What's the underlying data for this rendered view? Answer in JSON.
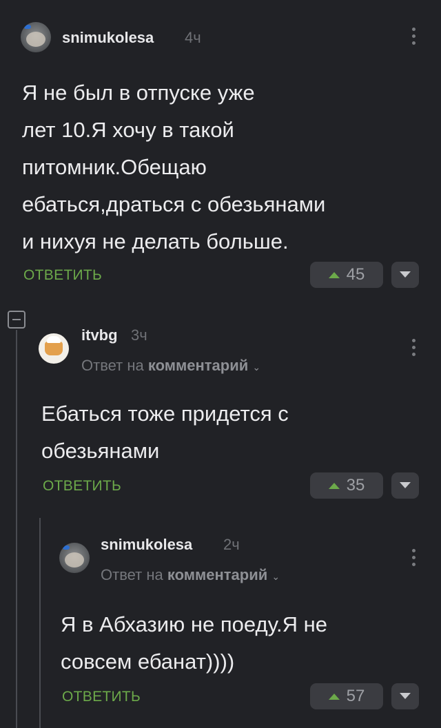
{
  "comments": [
    {
      "username": "snimukolesa",
      "time": "4ч",
      "lines": [
        "Я не был в отпуске уже",
        "лет 10.Я хочу в такой",
        "питомник.Обещаю",
        "ебаться,драться с обезьянами",
        "и нихуя не делать больше."
      ],
      "reply_label": "ОТВЕТИТЬ",
      "votes": "45",
      "avatar_icon": "monkey-avatar-icon"
    },
    {
      "username": "itvbg",
      "time": "3ч",
      "reply_to_prefix": "Ответ на",
      "reply_to_target": "комментарий",
      "lines": [
        "Ебаться тоже придется с",
        "обезьянами"
      ],
      "reply_label": "ОТВЕТИТЬ",
      "votes": "35",
      "avatar_icon": "chef-avatar-icon"
    },
    {
      "username": "snimukolesa",
      "time": "2ч",
      "reply_to_prefix": "Ответ на",
      "reply_to_target": "комментарий",
      "lines": [
        "Я в Абхазию не поеду.Я не",
        "совсем ебанат))))"
      ],
      "reply_label": "ОТВЕТИТЬ",
      "votes": "57",
      "avatar_icon": "monkey-avatar-icon"
    }
  ],
  "colors": {
    "background": "#212226",
    "accent_green": "#6ca94a",
    "button_bg": "#3b3c41"
  }
}
